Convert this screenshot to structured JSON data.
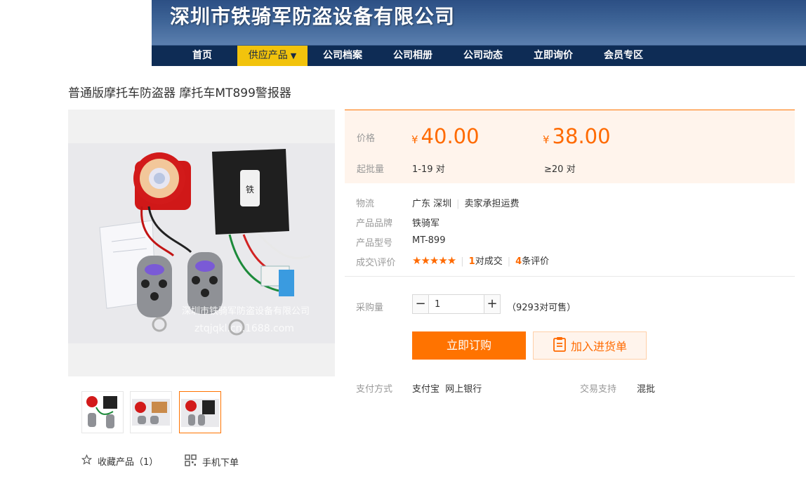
{
  "header": {
    "company_name": "深圳市铁骑军防盗设备有限公司",
    "nav": [
      {
        "label": "首页"
      },
      {
        "label": "供应产品",
        "active": true,
        "caret": "▼"
      },
      {
        "label": "公司档案"
      },
      {
        "label": "公司相册"
      },
      {
        "label": "公司动态"
      },
      {
        "label": "立即询价"
      },
      {
        "label": "会员专区"
      }
    ]
  },
  "product": {
    "title": "普通版摩托车防盗器 摩托车MT899警报器",
    "image_watermark": "深圳市铁骑军防盗设备有限公司",
    "image_watermark_url": "ztqjqkl.cn.1688.com",
    "thumbnails": [
      {
        "icon": "thumbnail-alarm-set-1"
      },
      {
        "icon": "thumbnail-alarm-set-2"
      },
      {
        "icon": "thumbnail-alarm-set-3",
        "selected": true
      }
    ],
    "favorite_label": "收藏产品（1）",
    "mobile_order_label": "手机下单"
  },
  "pricing": {
    "price_label": "价格",
    "moq_label": "起批量",
    "currency_symbol": "¥",
    "tiers": [
      {
        "price": "40.00",
        "range": "1-19 对"
      },
      {
        "price": "38.00",
        "range": "≥20 对"
      }
    ]
  },
  "details": {
    "logistics_label": "物流",
    "logistics_location": "广东 深圳",
    "logistics_shipping": "卖家承担运费",
    "brand_label": "产品品牌",
    "brand_value": "铁骑军",
    "model_label": "产品型号",
    "model_value": "MT-899",
    "deals_label": "成交\\评价",
    "rating_stars": 5,
    "stars_text": "★★★★★",
    "deals_count": "1",
    "deals_suffix": "对成交",
    "reviews_count": "4",
    "reviews_suffix": "条评价"
  },
  "purchase": {
    "qty_label": "采购量",
    "qty_value": "1",
    "stock_text": "（9293对可售）",
    "minus": "−",
    "plus": "+",
    "order_button": "立即订购",
    "cart_button": "加入进货单"
  },
  "payment": {
    "pay_label": "支付方式",
    "pay_methods": "支付宝  网上银行",
    "trade_label": "交易支持",
    "trade_value": "混批"
  },
  "colors": {
    "accent": "#ff7300",
    "nav_bg": "#0e2c55",
    "nav_active": "#f2c30c",
    "banner": "#3d6396",
    "price_bg": "#fff4ec"
  }
}
